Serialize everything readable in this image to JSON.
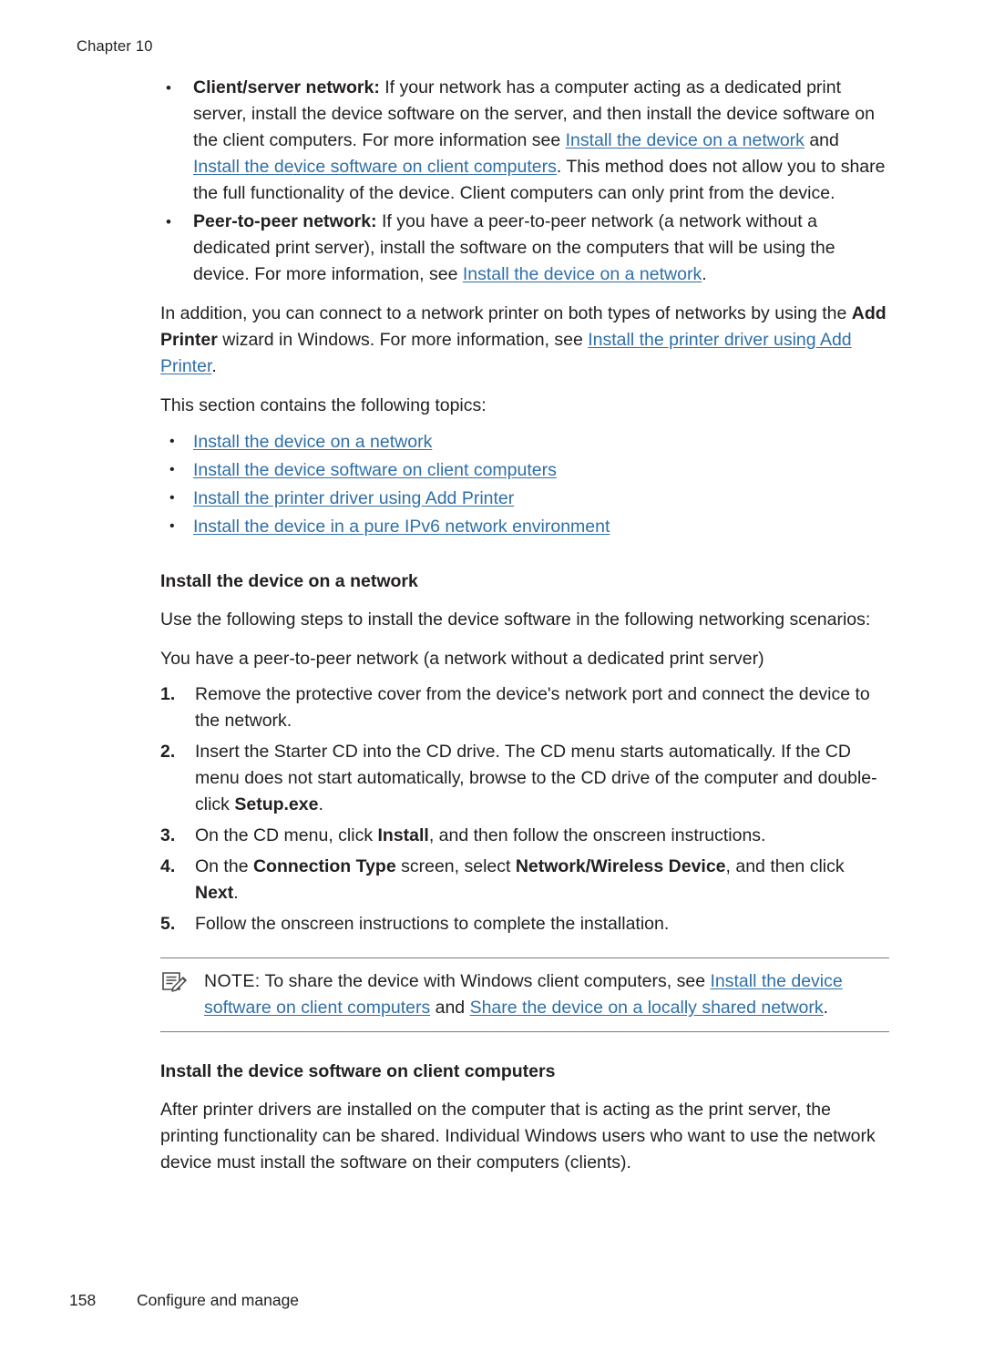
{
  "header": {
    "chapter": "Chapter 10"
  },
  "body": {
    "bullets": [
      {
        "title": "Client/server network:",
        "segments": [
          {
            "t": " If your network has a computer acting as a dedicated print server, install the device software on the server, and then install the device software on the client computers. For more information see ",
            "k": "text"
          },
          {
            "t": "Install the device on a network",
            "k": "link"
          },
          {
            "t": " and ",
            "k": "text"
          },
          {
            "t": "Install the device software on client computers",
            "k": "link"
          },
          {
            "t": ". This method does not allow you to share the full functionality of the device. Client computers can only print from the device.",
            "k": "text"
          }
        ]
      },
      {
        "title": "Peer-to-peer network:",
        "segments": [
          {
            "t": " If you have a peer-to-peer network (a network without a dedicated print server), install the software on the computers that will be using the device. For more information, see ",
            "k": "text"
          },
          {
            "t": "Install the device on a network",
            "k": "link"
          },
          {
            "t": ".",
            "k": "text"
          }
        ]
      }
    ],
    "paragraph_addprinter": [
      {
        "t": "In addition, you can connect to a network printer on both types of networks by using the ",
        "k": "text"
      },
      {
        "t": "Add Printer",
        "k": "bold"
      },
      {
        "t": " wizard in Windows. For more information, see ",
        "k": "text"
      },
      {
        "t": "Install the printer driver using Add Printer",
        "k": "link"
      },
      {
        "t": ".",
        "k": "text"
      }
    ],
    "topics_intro": "This section contains the following topics:",
    "topic_links": [
      "Install the device on a network",
      "Install the device software on client computers",
      "Install the printer driver using Add Printer",
      "Install the device in a pure IPv6 network environment"
    ],
    "section1": {
      "heading": "Install the device on a network",
      "intro": "Use the following steps to install the device software in the following networking scenarios:",
      "scenario": "You have a peer-to-peer network (a network without a dedicated print server)",
      "steps": [
        [
          {
            "t": "Remove the protective cover from the device's network port and connect the device to the network.",
            "k": "text"
          }
        ],
        [
          {
            "t": "Insert the Starter CD into the CD drive. The CD menu starts automatically. If the CD menu does not start automatically, browse to the CD drive of the computer and double-click ",
            "k": "text"
          },
          {
            "t": "Setup.exe",
            "k": "bold"
          },
          {
            "t": ".",
            "k": "text"
          }
        ],
        [
          {
            "t": "On the CD menu, click ",
            "k": "text"
          },
          {
            "t": "Install",
            "k": "bold"
          },
          {
            "t": ", and then follow the onscreen instructions.",
            "k": "text"
          }
        ],
        [
          {
            "t": "On the ",
            "k": "text"
          },
          {
            "t": "Connection Type",
            "k": "bold"
          },
          {
            "t": " screen, select ",
            "k": "text"
          },
          {
            "t": "Network/Wireless Device",
            "k": "bold"
          },
          {
            "t": ", and then click ",
            "k": "text"
          },
          {
            "t": "Next",
            "k": "bold"
          },
          {
            "t": ".",
            "k": "text"
          }
        ],
        [
          {
            "t": "Follow the onscreen instructions to complete the installation.",
            "k": "text"
          }
        ]
      ],
      "note": {
        "label": "NOTE:",
        "segments": [
          {
            "t": "   To share the device with Windows client computers, see ",
            "k": "text"
          },
          {
            "t": "Install the device software on client computers",
            "k": "link"
          },
          {
            "t": " and ",
            "k": "text"
          },
          {
            "t": "Share the device on a locally shared network",
            "k": "link"
          },
          {
            "t": ".",
            "k": "text"
          }
        ]
      }
    },
    "section2": {
      "heading": "Install the device software on client computers",
      "paragraph": "After printer drivers are installed on the computer that is acting as the print server, the printing functionality can be shared. Individual Windows users who want to use the network device must install the software on their computers (clients)."
    }
  },
  "footer": {
    "page_number": "158",
    "text": "Configure and manage"
  },
  "colors": {
    "link": "#2f6fa8",
    "text": "#231f20",
    "rule": "#7a7a7a"
  }
}
